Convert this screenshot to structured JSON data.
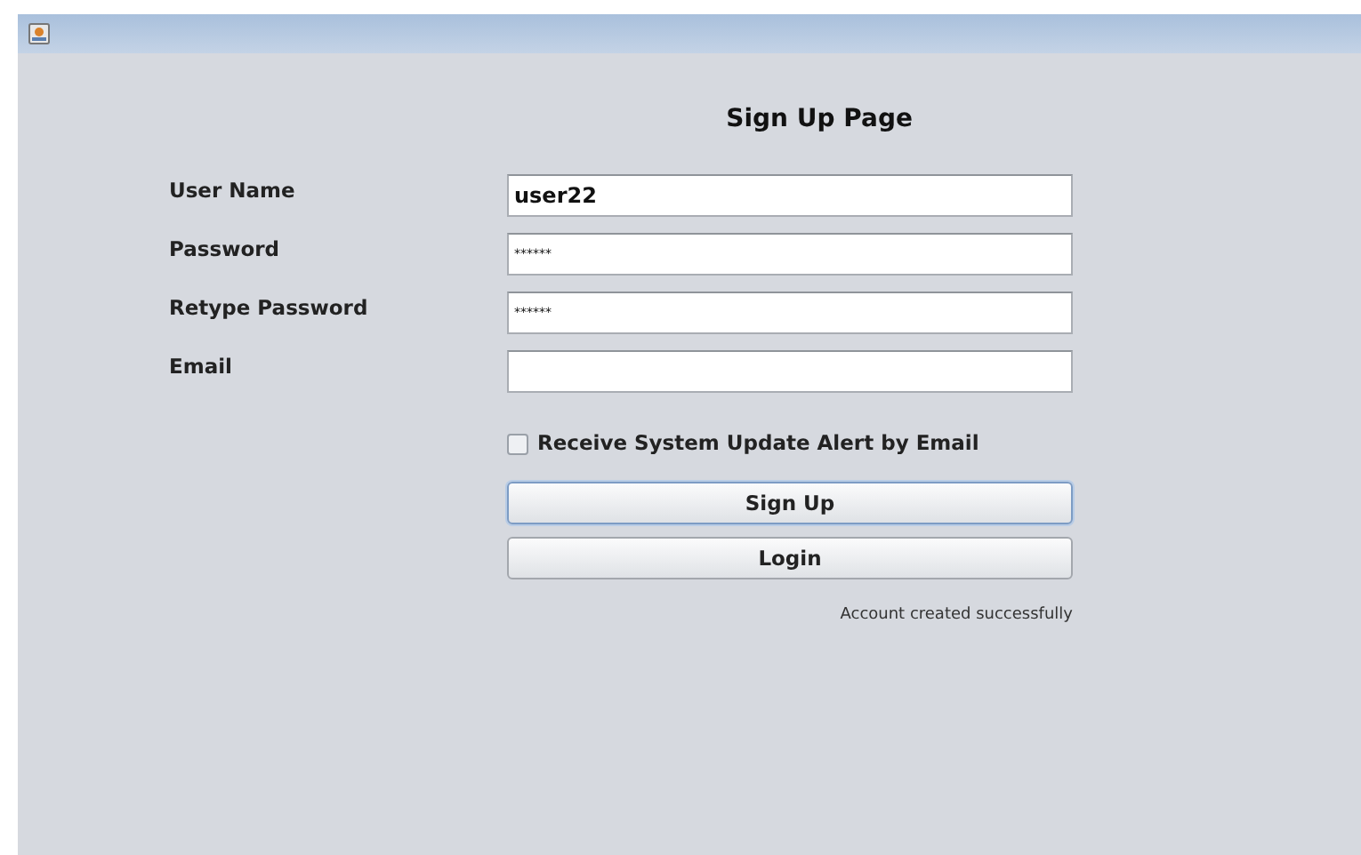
{
  "heading": "Sign Up Page",
  "fields": [
    {
      "label": "User Name",
      "kind": "text",
      "value": "user22"
    },
    {
      "label": "Password",
      "kind": "password",
      "value": "******"
    },
    {
      "label": "Retype Password",
      "kind": "password",
      "value": "******"
    },
    {
      "label": "Email",
      "kind": "text"
    }
  ],
  "checkbox": {
    "label": "Receive System Update Alert by Email",
    "checked": false
  },
  "buttons": [
    {
      "label": "Sign Up",
      "focused": true
    },
    {
      "label": "Login",
      "focused": false
    }
  ],
  "status_message": "Account created successfully"
}
